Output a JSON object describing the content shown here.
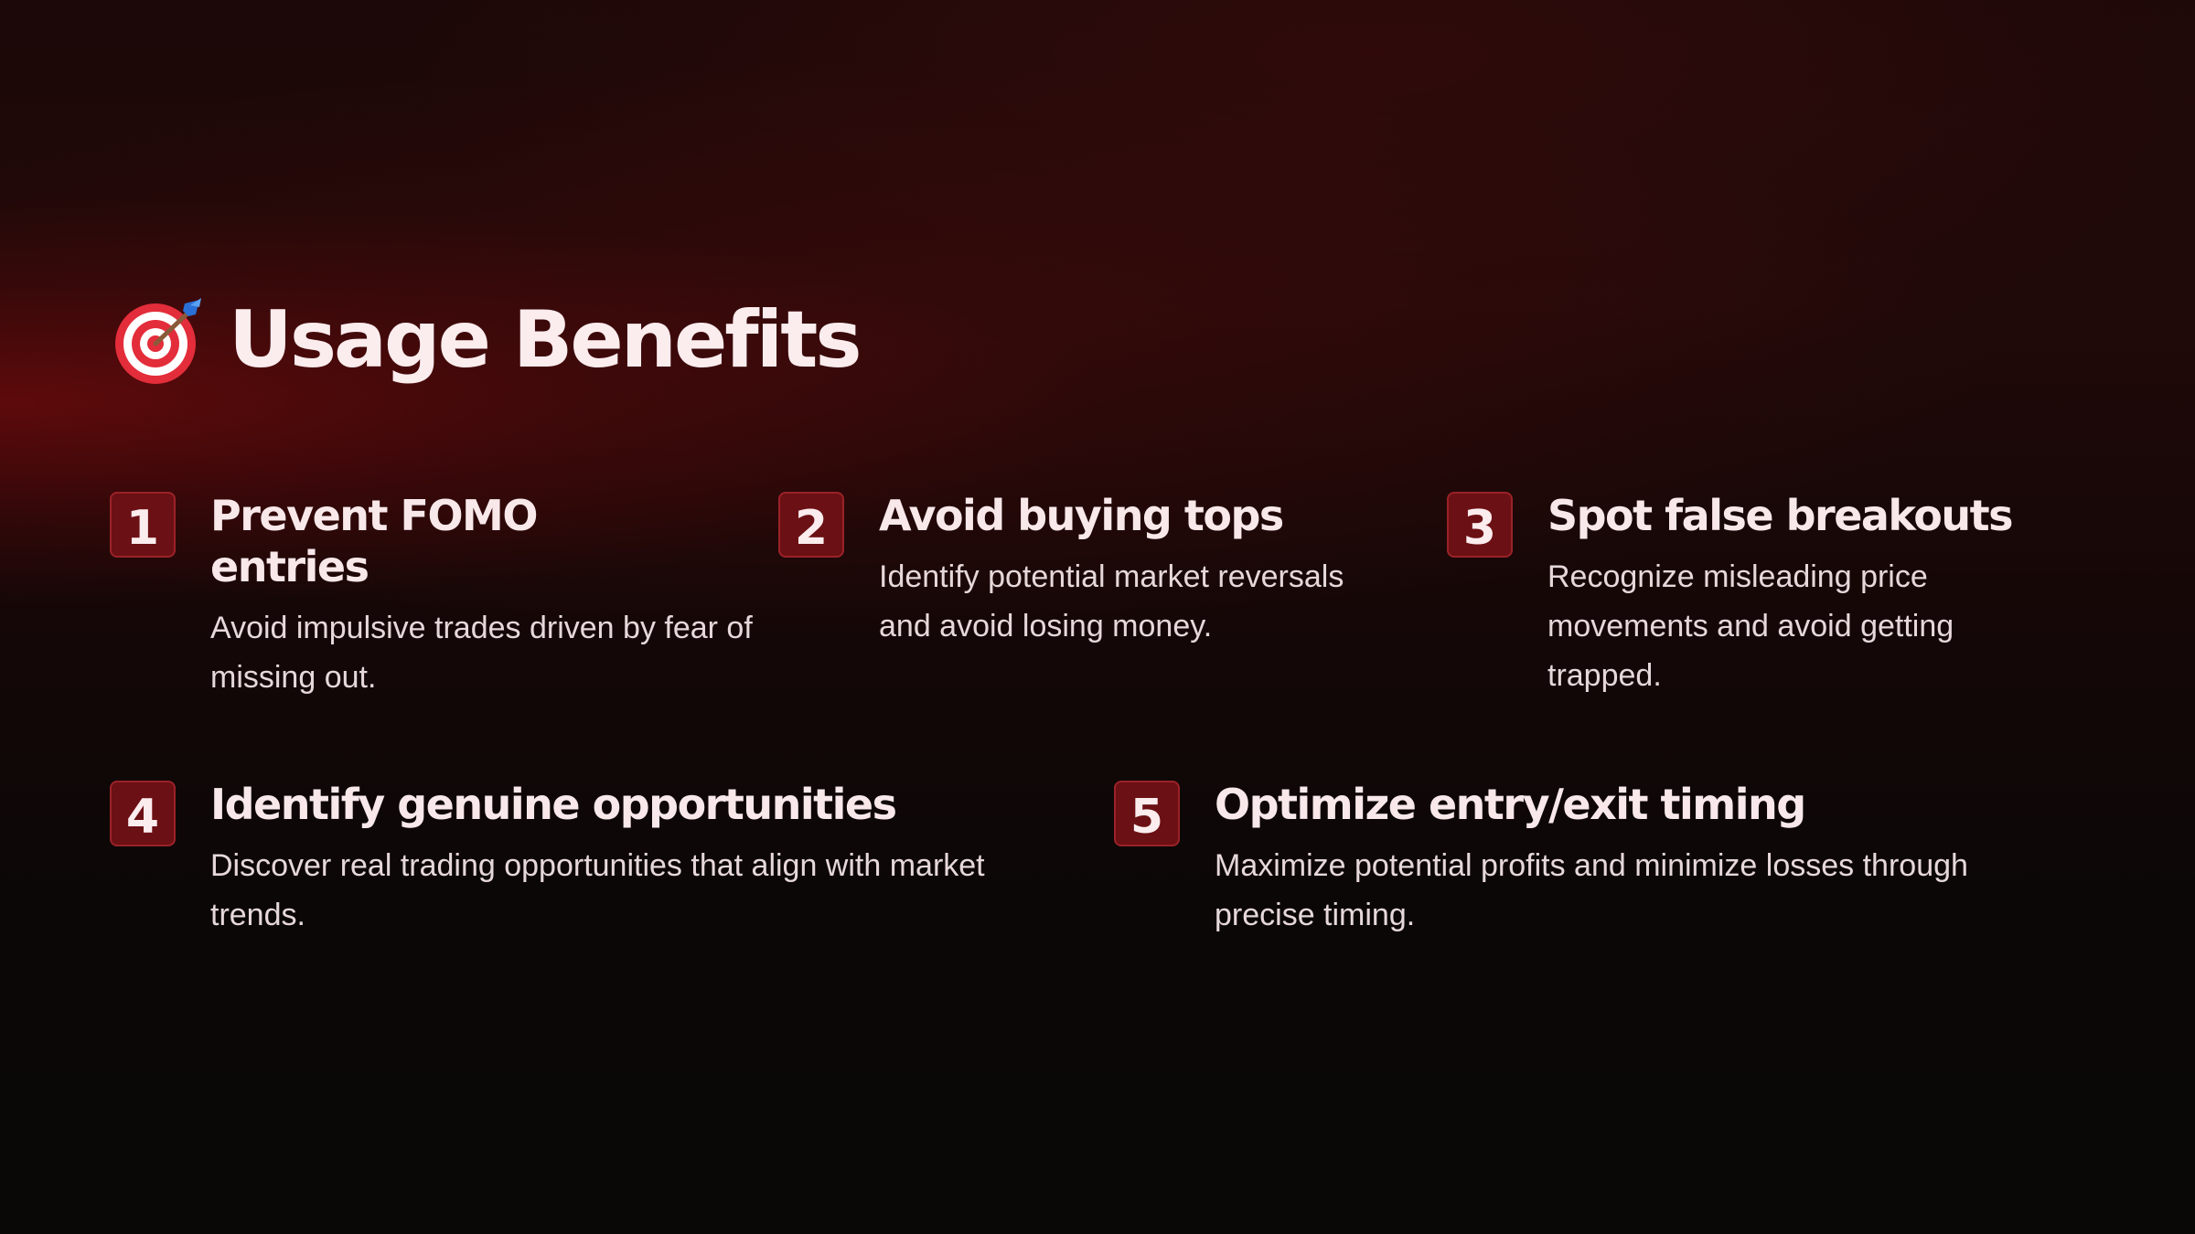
{
  "header": {
    "icon": "direct-hit-target-icon",
    "title": "Usage Benefits"
  },
  "benefits": [
    {
      "number": "1",
      "title": "Prevent FOMO entries",
      "description": "Avoid impulsive trades driven by fear of missing out."
    },
    {
      "number": "2",
      "title": "Avoid buying tops",
      "description": "Identify potential market reversals and avoid losing money."
    },
    {
      "number": "3",
      "title": "Spot false breakouts",
      "description": "Recognize misleading price movements and avoid getting trapped."
    },
    {
      "number": "4",
      "title": "Identify genuine opportunities",
      "description": "Discover real trading opportunities that align with market trends."
    },
    {
      "number": "5",
      "title": "Optimize entry/exit timing",
      "description": "Maximize potential profits and minimize losses through precise timing."
    }
  ],
  "colors": {
    "accent": "#6b1014",
    "accent_border": "#9a2228",
    "text": "#f8e8ea",
    "background": "#0b0707"
  }
}
